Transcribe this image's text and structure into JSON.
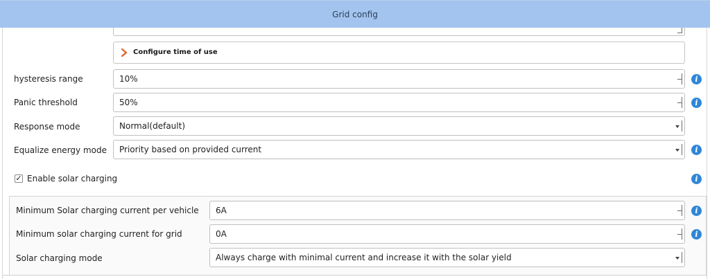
{
  "window": {
    "title": "Grid config"
  },
  "time_of_use": {
    "label": "Configure time of use"
  },
  "settings": [
    {
      "label": "hysteresis range",
      "value": "10%",
      "control": "spinbox",
      "has_info": true
    },
    {
      "label": "Panic threshold",
      "value": "50%",
      "control": "spinbox",
      "has_info": true
    },
    {
      "label": "Response mode",
      "value": "Normal(default)",
      "control": "combo",
      "has_info": false
    },
    {
      "label": "Equalize energy mode",
      "value": "Priority based on provided current",
      "control": "combo",
      "has_info": true
    }
  ],
  "solar": {
    "enable_label": "Enable solar charging",
    "enabled": true,
    "check_mark": "✓",
    "info_glyph": "i",
    "settings": [
      {
        "label": "Minimum Solar charging current per vehicle",
        "value": "6A",
        "control": "spinbox",
        "has_info": true
      },
      {
        "label": "Minimum solar charging current for grid",
        "value": "0A",
        "control": "spinbox",
        "has_info": true
      },
      {
        "label": "Solar charging mode",
        "value": "Always charge with minimal current and increase it with the solar yield",
        "control": "combo",
        "has_info": false
      }
    ]
  },
  "colors": {
    "titlebar": "#a2c4ee",
    "info_icon": "#2f86d8",
    "chevron": "#e0652a"
  },
  "icons": {
    "info": "info-icon",
    "chevron": "chevron-right-icon",
    "check": "checkmark-icon"
  }
}
